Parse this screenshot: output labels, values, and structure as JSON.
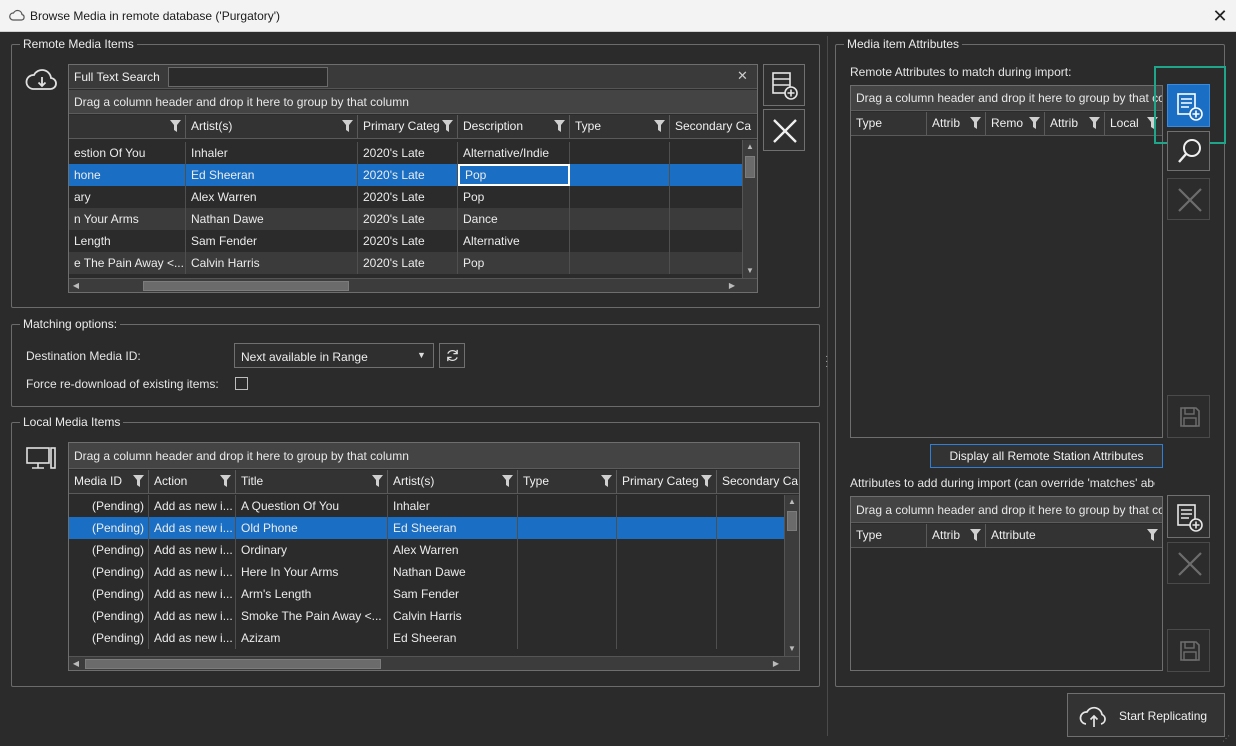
{
  "window": {
    "title": "Browse Media in remote database ('Purgatory')",
    "close": "✕"
  },
  "remote": {
    "group_label": "Remote Media Items",
    "search_label": "Full Text Search",
    "search_value": "",
    "drag_hint": "Drag a column header and drop it here to group by that column",
    "columns": [
      "",
      "Artist(s)",
      "Primary Categ",
      "Description",
      "Type",
      "Secondary Ca"
    ],
    "rows": [
      [
        "estion Of You",
        "Inhaler",
        "2020's Late",
        "Alternative/Indie",
        "",
        ""
      ],
      [
        "hone",
        "Ed Sheeran",
        "2020's Late",
        "Pop",
        "",
        ""
      ],
      [
        "ary",
        "Alex Warren",
        "2020's Late",
        "Pop",
        "",
        ""
      ],
      [
        "n Your Arms",
        "Nathan Dawe",
        "2020's Late",
        "Dance",
        "",
        ""
      ],
      [
        " Length",
        "Sam Fender",
        "2020's Late",
        "Alternative",
        "",
        ""
      ],
      [
        "e The Pain Away <...",
        "Calvin Harris",
        "2020's Late",
        "Pop",
        "",
        ""
      ]
    ]
  },
  "matching": {
    "group_label": "Matching options:",
    "dest_label": "Destination Media ID:",
    "dest_value": "Next available in Range",
    "force_label": "Force re-download of existing items:"
  },
  "local": {
    "group_label": "Local Media Items",
    "drag_hint": "Drag a column header and drop it here to group by that column",
    "columns": [
      "Media ID",
      "Action",
      "Title",
      "Artist(s)",
      "Type",
      "Primary Categ",
      "Secondary Ca"
    ],
    "rows": [
      [
        "(Pending)",
        "Add as new i...",
        "A Question Of You",
        "Inhaler",
        "",
        "",
        ""
      ],
      [
        "(Pending)",
        "Add as new i...",
        "Old Phone",
        "Ed Sheeran",
        "",
        "",
        ""
      ],
      [
        "(Pending)",
        "Add as new i...",
        "Ordinary",
        "Alex Warren",
        "",
        "",
        ""
      ],
      [
        "(Pending)",
        "Add as new i...",
        "Here In Your Arms",
        "Nathan Dawe",
        "",
        "",
        ""
      ],
      [
        "(Pending)",
        "Add as new i...",
        "Arm's Length",
        "Sam Fender",
        "",
        "",
        ""
      ],
      [
        "(Pending)",
        "Add as new i...",
        "Smoke The Pain Away <...",
        "Calvin Harris",
        "",
        "",
        ""
      ],
      [
        "(Pending)",
        "Add as new i...",
        "Azizam",
        "Ed Sheeran",
        "",
        "",
        ""
      ]
    ]
  },
  "attributes": {
    "group_label": "Media item Attributes",
    "match_label": "Remote Attributes to match during import:",
    "match_drag_hint": "Drag a column header and drop it here to group by that column",
    "match_columns": [
      "Type",
      "Attrib",
      "Remo",
      "Attrib",
      "Local"
    ],
    "display_all_button": "Display all Remote Station Attributes",
    "add_label": "Attributes to add during import (can override 'matches' above)",
    "add_drag_hint": "Drag a column header and drop it here to group by that column",
    "add_columns": [
      "Type",
      "Attrib",
      "Attribute"
    ]
  },
  "start_button": "Start Replicating"
}
